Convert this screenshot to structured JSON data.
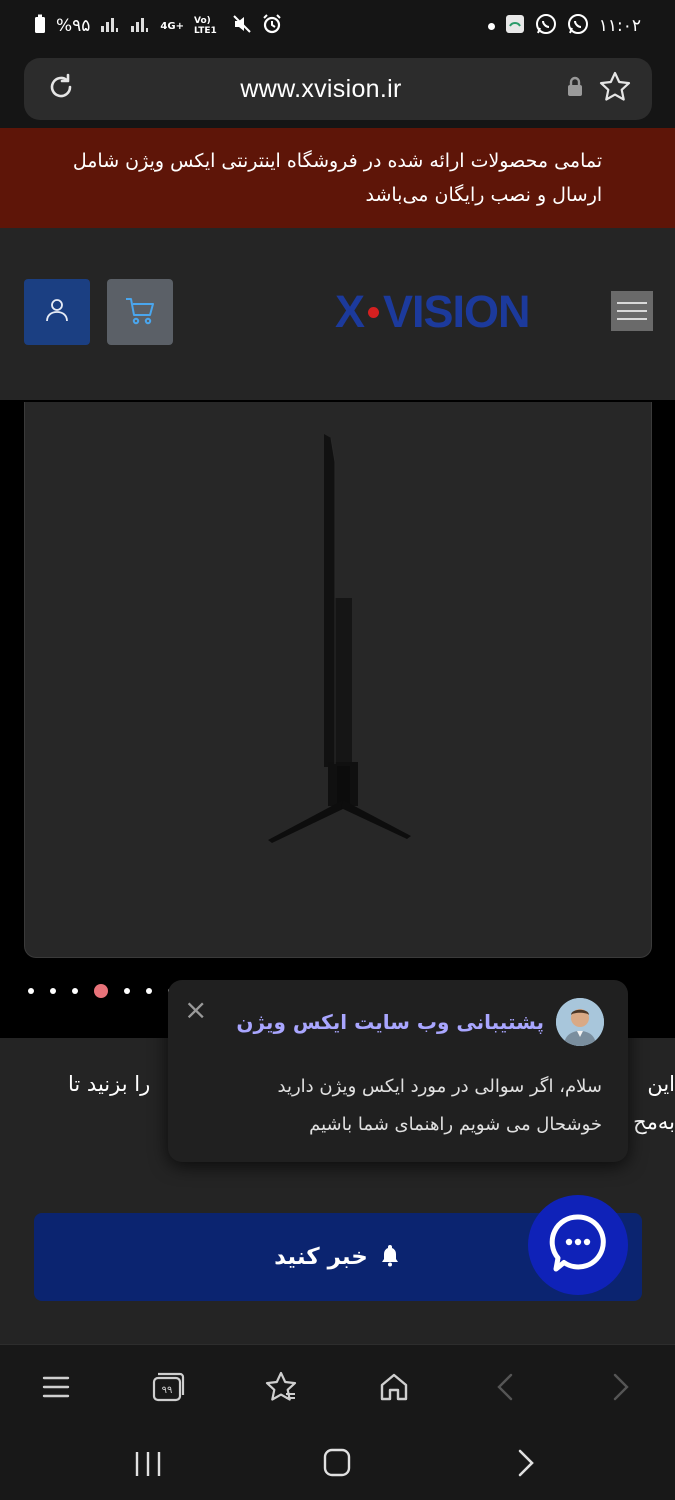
{
  "status_bar": {
    "battery": "%۹۵",
    "network": "4G+",
    "volte": "Vo) LTE1",
    "time": "۱۱:۰۲"
  },
  "browser": {
    "url": "www.xvision.ir"
  },
  "banner": {
    "line1": "تمامی محصولات ارائه شده در فروشگاه اینترنتی ایکس ویژن شامل",
    "line2": "ارسال و نصب رایگان می‌باشد"
  },
  "header": {
    "logo_left": "X",
    "logo_right": "VISION"
  },
  "carousel": {
    "dot_count": 7,
    "active_index": 3
  },
  "info": {
    "line1_left": "را بزنید تا",
    "line1_right": "این",
    "line2_right": "به‌مح"
  },
  "notify_button": {
    "label": "خبر کنید"
  },
  "chat": {
    "title": "پشتیبانی وب سایت ایکس ویژن",
    "message_line1": "سلام، اگر سوالی در مورد ایکس ویژن دارید",
    "message_line2": "خوشحال می شویم راهنمای شما باشیم",
    "close_symbol": "×"
  },
  "colors": {
    "banner_bg": "#5e1508",
    "brand_blue": "#1c3a9c",
    "notify_bg": "#0b2470",
    "chat_title": "#a9a6ff",
    "fab_bg": "#0f22b8"
  }
}
